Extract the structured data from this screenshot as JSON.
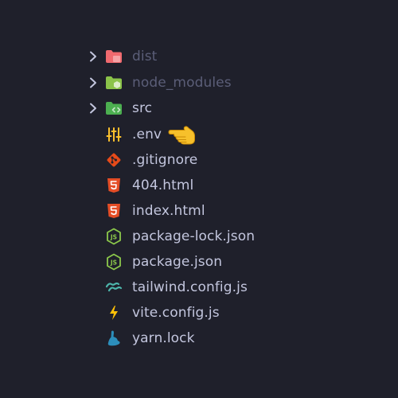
{
  "explorer": {
    "items": [
      {
        "label": "dist",
        "kind": "folder",
        "expanded": false,
        "dimmed": true,
        "icon": "folder-dist-icon",
        "color": "#f06a6f"
      },
      {
        "label": "node_modules",
        "kind": "folder",
        "expanded": false,
        "dimmed": true,
        "icon": "folder-node-icon",
        "color": "#8bc34a"
      },
      {
        "label": "src",
        "kind": "folder",
        "expanded": false,
        "dimmed": false,
        "icon": "folder-src-icon",
        "color": "#4caf50"
      },
      {
        "label": ".env",
        "kind": "file",
        "dimmed": false,
        "icon": "env-settings-icon",
        "color": "#fbc02d"
      },
      {
        "label": ".gitignore",
        "kind": "file",
        "dimmed": false,
        "icon": "git-icon",
        "color": "#e64a19"
      },
      {
        "label": "404.html",
        "kind": "file",
        "dimmed": false,
        "icon": "html5-icon",
        "color": "#e44d26"
      },
      {
        "label": "index.html",
        "kind": "file",
        "dimmed": false,
        "icon": "html5-icon",
        "color": "#e44d26"
      },
      {
        "label": "package-lock.json",
        "kind": "file",
        "dimmed": false,
        "icon": "nodejs-icon",
        "color": "#8cc84b"
      },
      {
        "label": "package.json",
        "kind": "file",
        "dimmed": false,
        "icon": "nodejs-icon",
        "color": "#8cc84b"
      },
      {
        "label": "tailwind.config.js",
        "kind": "file",
        "dimmed": false,
        "icon": "tailwind-icon",
        "color": "#4db6ac"
      },
      {
        "label": "vite.config.js",
        "kind": "file",
        "dimmed": false,
        "icon": "vite-lightning-icon",
        "color": "#ffc107"
      },
      {
        "label": "yarn.lock",
        "kind": "file",
        "dimmed": false,
        "icon": "yarn-icon",
        "color": "#2c8ebb"
      }
    ],
    "pointer": {
      "icon": "pointing-hand-icon",
      "target": ".env"
    }
  },
  "colors": {
    "background": "#1f202b",
    "text": "#c3c6de",
    "text_dim": "#5b5e78",
    "chevron": "#c3c6de"
  }
}
